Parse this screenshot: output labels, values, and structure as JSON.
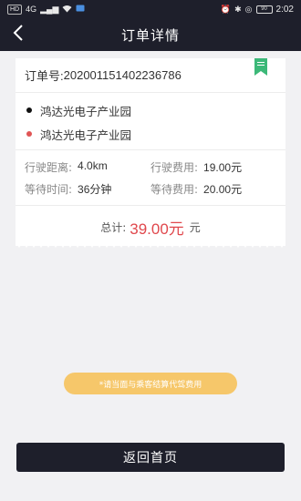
{
  "status_bar": {
    "network_chip": "HD",
    "signal_text": "4G",
    "battery_text": "90",
    "time": "2:02"
  },
  "header": {
    "title": "订单详情",
    "back_icon": "chevron-left-icon"
  },
  "order": {
    "number_label": "订单号:",
    "number": "20200115140223678​6",
    "badge_icon": "bookmark-icon",
    "badge_color": "#3cb878",
    "start_address": "鸿达光电子产业园",
    "end_address": "鸿达光电子产业园",
    "start_dot_color": "#111111",
    "end_dot_color": "#e05555",
    "fees": [
      {
        "label": "行驶距离:",
        "value": "4.0km"
      },
      {
        "label": "行驶费用:",
        "value": "19.00元"
      },
      {
        "label": "等待时间:",
        "value": "36分钟"
      },
      {
        "label": "等待费用:",
        "value": "20.00元"
      }
    ],
    "total_label": "总计:",
    "total_amount": "39.00元",
    "total_unit": "元"
  },
  "notice": {
    "text": "*请当面与乘客结算代驾费用",
    "color": "#f6c76a"
  },
  "actions": {
    "home_label": "返回首页"
  },
  "colors": {
    "dark": "#1e1f2b",
    "accent_red": "#e0474c",
    "background": "#f1f1f3"
  }
}
